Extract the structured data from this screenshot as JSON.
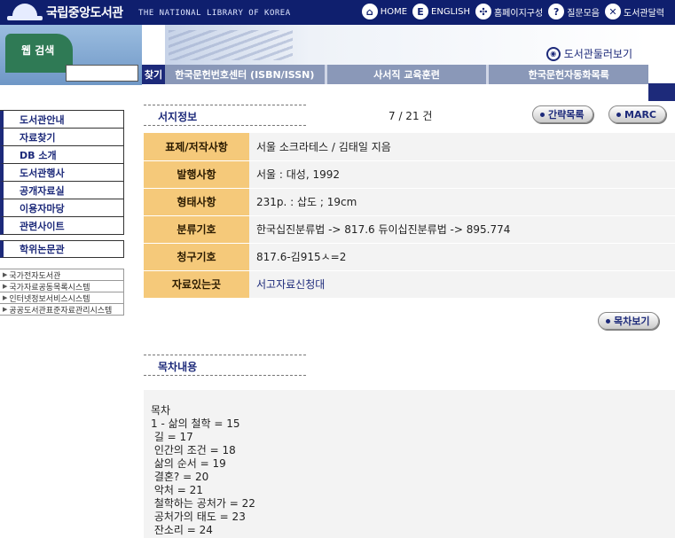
{
  "header": {
    "logo_ko": "국립중앙도서관",
    "logo_en": "THE NATIONAL LIBRARY OF KOREA",
    "toplinks": [
      {
        "icon": "home-icon",
        "glyph": "⌂",
        "label": "HOME"
      },
      {
        "icon": "english-icon",
        "glyph": "E",
        "label": "ENGLISH"
      },
      {
        "icon": "sitemap-icon",
        "glyph": "✣",
        "label": "홈페이지구성"
      },
      {
        "icon": "question-icon",
        "glyph": "?",
        "label": "질문모음"
      },
      {
        "icon": "calendar-icon",
        "glyph": "✕",
        "label": "도서관달력"
      }
    ],
    "search_tab": "웹 검색",
    "search_value": "",
    "search_button": "찾기",
    "tour_label": "도서관둘러보기",
    "nav": [
      "한국문헌번호센터 (ISBN/ISSN)",
      "사서직 교육훈련",
      "한국문헌자동화목록"
    ]
  },
  "sidebar": {
    "menu": [
      "도서관안내",
      "자료찾기",
      "DB 소개",
      "도서관행사",
      "공개자료실",
      "이용자마당",
      "관련사이트"
    ],
    "single": "학위논문관",
    "links": [
      "국가전자도서관",
      "국가자료공동목록시스템",
      "인터넷정보서비스시스템",
      "공공도서관표준자료관리시스템"
    ]
  },
  "main": {
    "section_title": "서지정보",
    "counter": "7 / 21 건",
    "brief_button": "간략목록",
    "marc_button": "MARC",
    "rows": [
      {
        "label": "표제/저작사항",
        "value": "서울 소크라테스 / 김태일 지음"
      },
      {
        "label": "발행사항",
        "value": "서울 : 대성, 1992"
      },
      {
        "label": "형태사항",
        "value": "231p. : 삽도 ; 19cm"
      },
      {
        "label": "분류기호",
        "value": "한국십진분류법 -> 817.6 듀이십진분류법 -> 895.774"
      },
      {
        "label": "청구기호",
        "value": "817.6-김915ㅅ=2"
      },
      {
        "label": "자료있는곳",
        "value": "서고자료신청대"
      }
    ],
    "toc_button": "목차보기",
    "toc_title": "목차내용",
    "toc_text": "목차\n1 - 삶의 철학 = 15\n 길 = 17\n 인간의 조건 = 18\n 삶의 순서 = 19\n 결혼? = 20\n 악처 = 21\n 철학하는 공처가 = 22\n 공처가의 태도 = 23\n 잔소리 = 24"
  }
}
